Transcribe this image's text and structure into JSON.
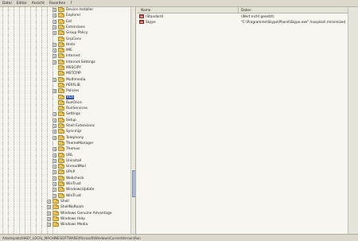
{
  "menu": [
    "Datei",
    "Editor",
    "Ansicht",
    "Favoriten",
    "?"
  ],
  "tree": {
    "items": [
      {
        "label": "Device Installer",
        "expander": "+",
        "selected": false
      },
      {
        "label": "Explorer",
        "expander": "+",
        "selected": false
      },
      {
        "label": "Ext",
        "expander": "+",
        "selected": false
      },
      {
        "label": "Extensions",
        "expander": "+",
        "selected": false
      },
      {
        "label": "Group Policy",
        "expander": "+",
        "selected": false
      },
      {
        "label": "GrpConv",
        "expander": "",
        "selected": false
      },
      {
        "label": "Hints",
        "expander": "+",
        "selected": false
      },
      {
        "label": "IME",
        "expander": "+",
        "selected": false
      },
      {
        "label": "Internet",
        "expander": "+",
        "selected": false
      },
      {
        "label": "Internet Settings",
        "expander": "+",
        "selected": false
      },
      {
        "label": "MSSCIPY",
        "expander": "",
        "selected": false
      },
      {
        "label": "MSTCPIP",
        "expander": "",
        "selected": false
      },
      {
        "label": "Multimedia",
        "expander": "+",
        "selected": false
      },
      {
        "label": "PERFLIB",
        "expander": "",
        "selected": false
      },
      {
        "label": "Policies",
        "expander": "+",
        "selected": false
      },
      {
        "label": "Run",
        "expander": "",
        "selected": true
      },
      {
        "label": "RunOnce",
        "expander": "",
        "selected": false
      },
      {
        "label": "RunServices",
        "expander": "",
        "selected": false
      },
      {
        "label": "Settings",
        "expander": "+",
        "selected": false
      },
      {
        "label": "Setup",
        "expander": "+",
        "selected": false
      },
      {
        "label": "Shell Extensions",
        "expander": "+",
        "selected": false
      },
      {
        "label": "Syncmgr",
        "expander": "+",
        "selected": false
      },
      {
        "label": "Telephony",
        "expander": "+",
        "selected": false
      },
      {
        "label": "ThemeManager",
        "expander": "",
        "selected": false
      },
      {
        "label": "Themes",
        "expander": "+",
        "selected": false
      },
      {
        "label": "URL",
        "expander": "+",
        "selected": false
      },
      {
        "label": "Uninstall",
        "expander": "+",
        "selected": false
      },
      {
        "label": "UnreadMail",
        "expander": "+",
        "selected": false
      },
      {
        "label": "UPnP",
        "expander": "+",
        "selected": false
      },
      {
        "label": "Webcheck",
        "expander": "+",
        "selected": false
      },
      {
        "label": "WinTrust",
        "expander": "+",
        "selected": false
      },
      {
        "label": "WindowsUpdate",
        "expander": "+",
        "selected": false
      },
      {
        "label": "WinTrust",
        "expander": "+",
        "selected": false
      },
      {
        "label": "Shell",
        "expander": "+",
        "selected": false
      },
      {
        "label": "ShellNoRoam",
        "expander": "+",
        "selected": false
      },
      {
        "label": "Windows Genuine Advantage",
        "expander": "+",
        "selected": false
      },
      {
        "label": "Windows Help",
        "expander": "+",
        "selected": false
      },
      {
        "label": "Windows Media",
        "expander": "+",
        "selected": false
      }
    ]
  },
  "list": {
    "header_name": "Name",
    "header_value": "Daten",
    "rows": [
      {
        "name": "(Standard)",
        "value": "(Wert nicht gesetzt)"
      },
      {
        "name": "Skype",
        "value": "\"C:\\Programme\\Skype\\Phone\\Skype.exe\" /nosplash /minimized"
      }
    ]
  },
  "statusbar": {
    "text": "Arbeitsplatz\\HKEY_LOCAL_MACHINE\\SOFTWARE\\Microsoft\\Windows\\CurrentVersion\\Run"
  }
}
